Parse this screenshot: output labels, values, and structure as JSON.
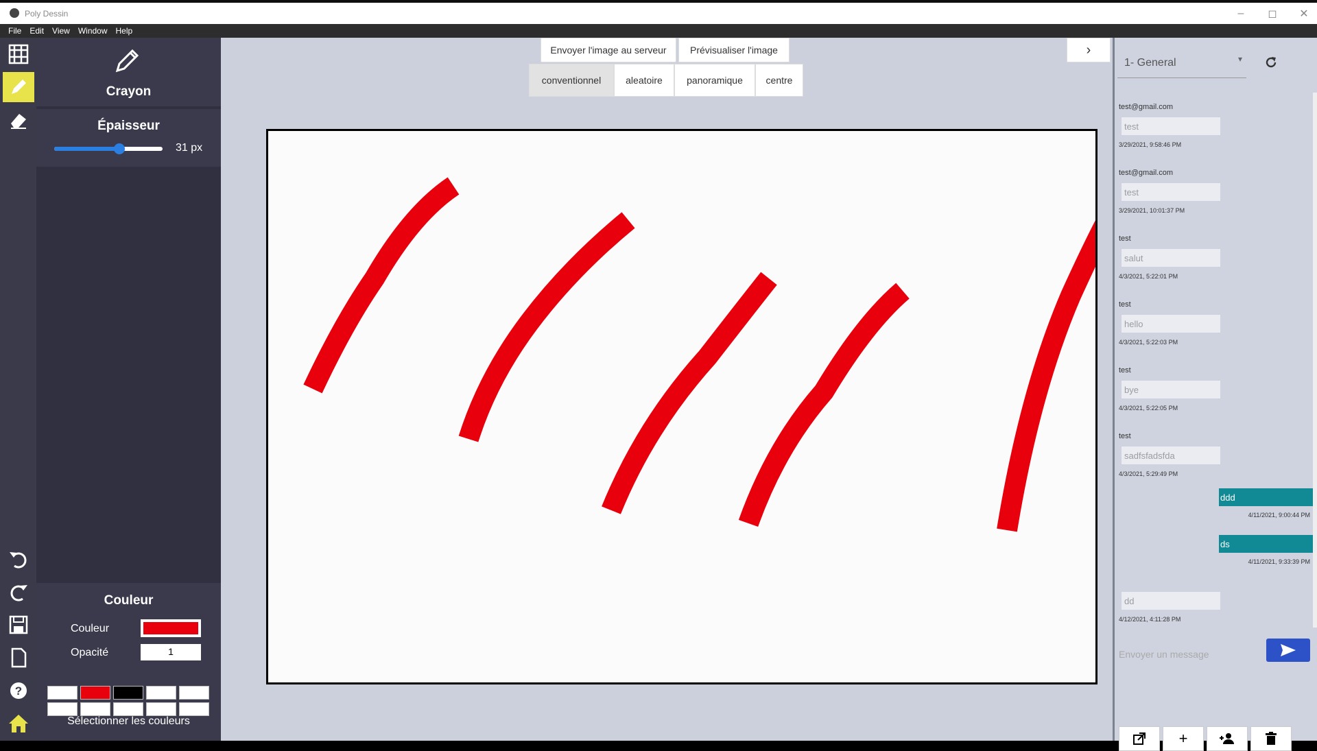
{
  "window": {
    "title": "Poly Dessin"
  },
  "menu": [
    "File",
    "Edit",
    "View",
    "Window",
    "Help"
  ],
  "tool": {
    "name": "Crayon"
  },
  "thickness": {
    "title": "Épaisseur",
    "value_label": "31 px",
    "level": 0.6
  },
  "color_section": {
    "title": "Couleur",
    "color_label": "Couleur",
    "color_value": "#e8000d",
    "opacity_label": "Opacité",
    "opacity_value": "1",
    "select_label": "Sélectionner les couleurs"
  },
  "swatches": [
    "#ffffff",
    "#e8000d",
    "#000000",
    "#ffffff",
    "#ffffff",
    "#ffffff",
    "#ffffff",
    "#ffffff",
    "#ffffff",
    "#ffffff"
  ],
  "top_actions": {
    "send": "Envoyer l'image au serveur",
    "preview": "Prévisualiser l'image"
  },
  "modes": [
    "conventionnel",
    "aleatoire",
    "panoramique",
    "centre"
  ],
  "modes_selected": "conventionnel",
  "stroke_color": "#e8000d",
  "chat": {
    "channel": "1- General",
    "messages": [
      {
        "sender": "test@gmail.com",
        "text": "test",
        "time": "3/29/2021, 9:58:46 PM"
      },
      {
        "sender": "test@gmail.com",
        "text": "test",
        "time": "3/29/2021, 10:01:37 PM"
      },
      {
        "sender": "test",
        "text": "salut",
        "time": "4/3/2021, 5:22:01 PM"
      },
      {
        "sender": "test",
        "text": "hello",
        "time": "4/3/2021, 5:22:03 PM"
      },
      {
        "sender": "test",
        "text": "bye",
        "time": "4/3/2021, 5:22:05 PM"
      },
      {
        "sender": "test",
        "text": "sadfsfadsfda",
        "time": "4/3/2021, 5:29:49 PM"
      }
    ],
    "own_messages": [
      {
        "text": "ddd",
        "time": "4/11/2021, 9:00:44 PM"
      },
      {
        "text": "ds",
        "time": "4/11/2021, 9:33:39 PM"
      }
    ],
    "last_message": {
      "text": "dd",
      "time": "4/12/2021, 4:11:28 PM"
    },
    "input_placeholder": "Envoyer un message"
  }
}
